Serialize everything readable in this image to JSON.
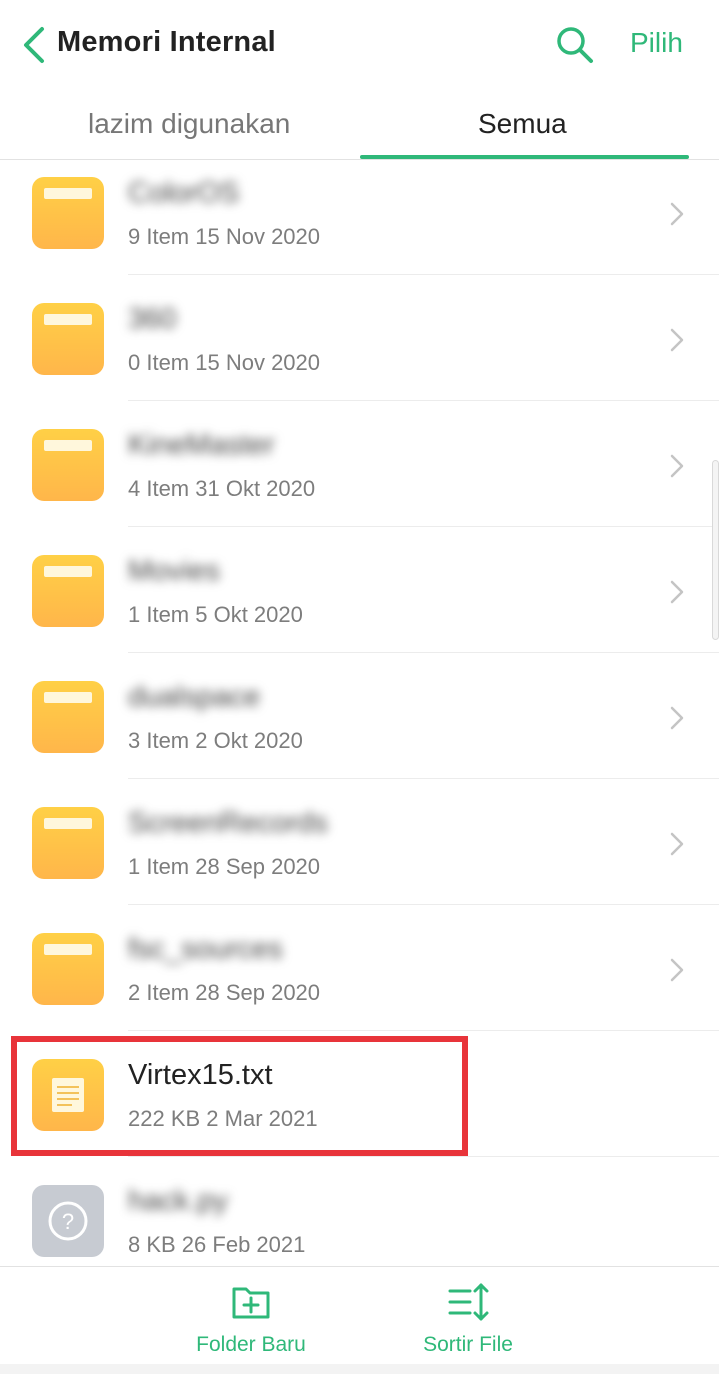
{
  "header": {
    "title": "Memori Internal",
    "back_icon": "chevron-left-icon",
    "search_icon": "search-icon",
    "select_label": "Pilih",
    "accent_color": "#2fb879"
  },
  "tabs": [
    {
      "label": "lazim digunakan",
      "active": false
    },
    {
      "label": "Semua",
      "active": true
    }
  ],
  "files": [
    {
      "name": "ColorOS",
      "meta": "9 Item  15 Nov 2020",
      "type": "folder",
      "name_blurred": true
    },
    {
      "name": "360",
      "meta": "0 Item  15 Nov 2020",
      "type": "folder",
      "name_blurred": true
    },
    {
      "name": "KineMaster",
      "meta": "4 Item  31 Okt 2020",
      "type": "folder",
      "name_blurred": true
    },
    {
      "name": "Movies",
      "meta": "1 Item  5 Okt 2020",
      "type": "folder",
      "name_blurred": true
    },
    {
      "name": "dualspace",
      "meta": "3 Item  2 Okt 2020",
      "type": "folder",
      "name_blurred": true
    },
    {
      "name": "ScreenRecords",
      "meta": "1 Item  28 Sep 2020",
      "type": "folder",
      "name_blurred": true
    },
    {
      "name": "fsc_sources",
      "meta": "2 Item  28 Sep 2020",
      "type": "folder",
      "name_blurred": true
    },
    {
      "name": "Virtex15.txt",
      "meta": "222 KB  2 Mar 2021",
      "type": "text-file",
      "name_blurred": false,
      "highlighted": true
    },
    {
      "name": "hack.py",
      "meta": "8 KB  26 Feb 2021",
      "type": "unknown-file",
      "name_blurred": true
    }
  ],
  "highlight_color": "#e8343a",
  "bottom_bar": {
    "new_folder_label": "Folder Baru",
    "new_folder_icon": "folder-plus-icon",
    "sort_label": "Sortir File",
    "sort_icon": "sort-icon"
  }
}
